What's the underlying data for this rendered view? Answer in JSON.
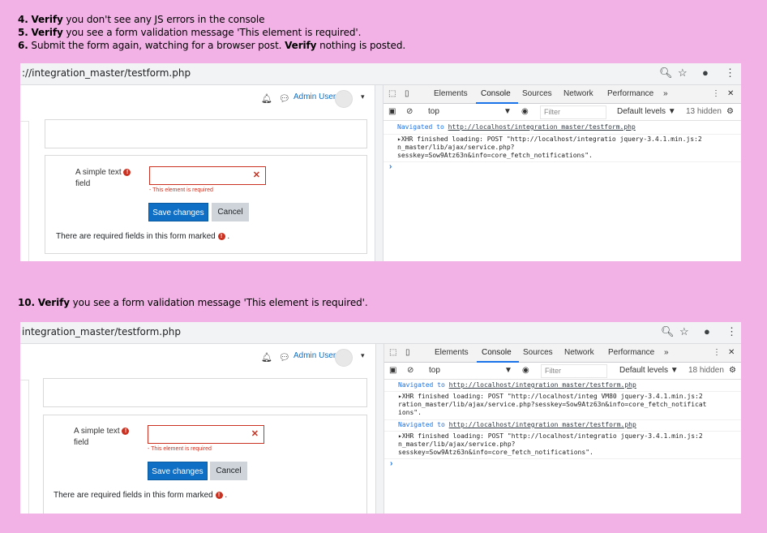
{
  "steps_top": [
    {
      "num": "4.",
      "verb": "Verify",
      "rest": " you don't see any JS errors in the console"
    },
    {
      "num": "5.",
      "verb": "Verify",
      "rest": " you see a form validation message 'This element is required'."
    },
    {
      "num": "6.",
      "pre": " Submit the form again, watching for a browser post. ",
      "verb": "Verify",
      "rest": " nothing is posted."
    }
  ],
  "step10": {
    "num": "10.",
    "verb": "Verify",
    "rest": " you see a form validation message 'This element is required'."
  },
  "shot1": {
    "url": "://integration_master/testform.php",
    "user": "Admin User",
    "field_label_line1": "A simple text",
    "field_label_line2": "field",
    "field_error": "- This element is required",
    "save": "Save changes",
    "cancel": "Cancel",
    "required_note": "There are required fields in this form marked",
    "required_dot": ".",
    "devtabs": [
      "Elements",
      "Console",
      "Sources",
      "Network",
      "Performance",
      "»"
    ],
    "context": "top",
    "filter_placeholder": "Filter",
    "levels": "Default levels ▼",
    "hidden": "13 hidden",
    "logs": [
      {
        "prefix": "Navigated to ",
        "link": "http://localhost/integration_master/testform.php"
      },
      {
        "lines": [
          "▸XHR finished loading: POST \"http://localhost/integratio  jquery-3.4.1.min.js:2",
          "n_master/lib/ajax/service.php?",
          "sesskey=Sow9Atz63n&info=core_fetch_notifications\"."
        ]
      }
    ],
    "prompt": "›"
  },
  "shot2": {
    "url": "integration_master/testform.php",
    "user": "Admin User",
    "field_label_line1": "A simple text",
    "field_label_line2": "field",
    "field_error": "- This element is required",
    "save": "Save changes",
    "cancel": "Cancel",
    "required_note": "There are required fields in this form marked",
    "required_dot": ".",
    "devtabs": [
      "Elements",
      "Console",
      "Sources",
      "Network",
      "Performance",
      "»"
    ],
    "context": "top",
    "filter_placeholder": "Filter",
    "levels": "Default levels ▼",
    "hidden": "18 hidden",
    "logs": [
      {
        "prefix": "Navigated to ",
        "link": "http://localhost/integration_master/testform.php"
      },
      {
        "lines": [
          "▸XHR finished loading: POST \"http://localhost/integ  VM80 jquery-3.4.1.min.js:2",
          "ration_master/lib/ajax/service.php?sesskey=Sow9Atz63n&info=core_fetch_notificat",
          "ions\"."
        ]
      },
      {
        "prefix": "Navigated to ",
        "link": "http://localhost/integration_master/testform.php"
      },
      {
        "lines": [
          "▸XHR finished loading: POST \"http://localhost/integratio  jquery-3.4.1.min.js:2",
          "n_master/lib/ajax/service.php?",
          "sesskey=Sow9Atz63n&info=core_fetch_notifications\"."
        ]
      }
    ],
    "prompt": "›"
  },
  "colors": {
    "background": "#f2b2e6",
    "primary": "#0f6fc5",
    "error": "#ca3120",
    "devtools_accent": "#1a73e8"
  },
  "icons": [
    "zoom-icon",
    "star-icon",
    "account-icon",
    "kebab-menu-icon",
    "bell-icon",
    "chat-icon",
    "inspect-icon",
    "device-toolbar-icon",
    "sidebar-toggle-icon",
    "clear-console-icon",
    "eye-icon",
    "gear-icon",
    "close-icon",
    "error-icon"
  ]
}
